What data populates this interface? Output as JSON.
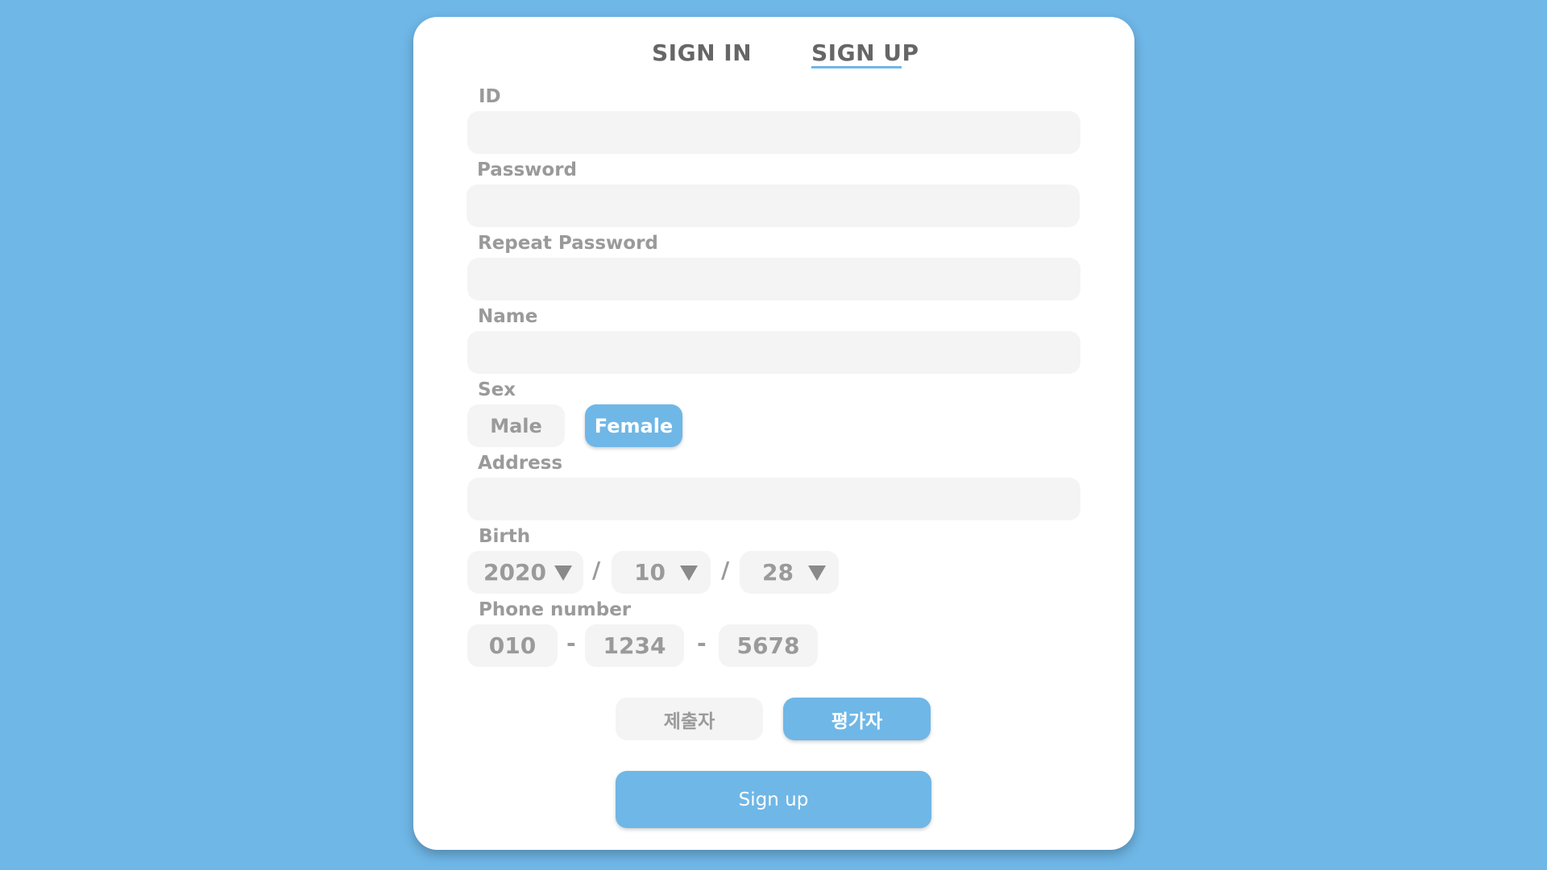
{
  "tabs": {
    "signin": "SIGN IN",
    "signup": "SIGN UP",
    "active": "SIGN UP"
  },
  "form": {
    "id_label": "ID",
    "password_label": "Password",
    "repeat_password_label": "Repeat Password",
    "name_label": "Name",
    "sex_label": "Sex",
    "sex_options": [
      "Male",
      "Female"
    ],
    "sex_selected": "Female",
    "address_label": "Address",
    "birth_label": "Birth",
    "birth": {
      "year": "2020",
      "month": "10",
      "day": "28",
      "separator": "/"
    },
    "phone_label": "Phone number",
    "phone": {
      "part1": "010",
      "part2": "1234",
      "part3": "5678",
      "separator": "-"
    },
    "roles": [
      "제출자",
      "평가자"
    ],
    "role_selected": "평가자",
    "submit_label": "Sign up"
  },
  "colors": {
    "background": "#6fb7e7",
    "accent": "#6fb7e7",
    "input_bg": "#f4f4f4",
    "label": "#9a9a9a",
    "tab_text": "#666666"
  },
  "icons": {
    "select_arrow": "caret-down-icon"
  }
}
